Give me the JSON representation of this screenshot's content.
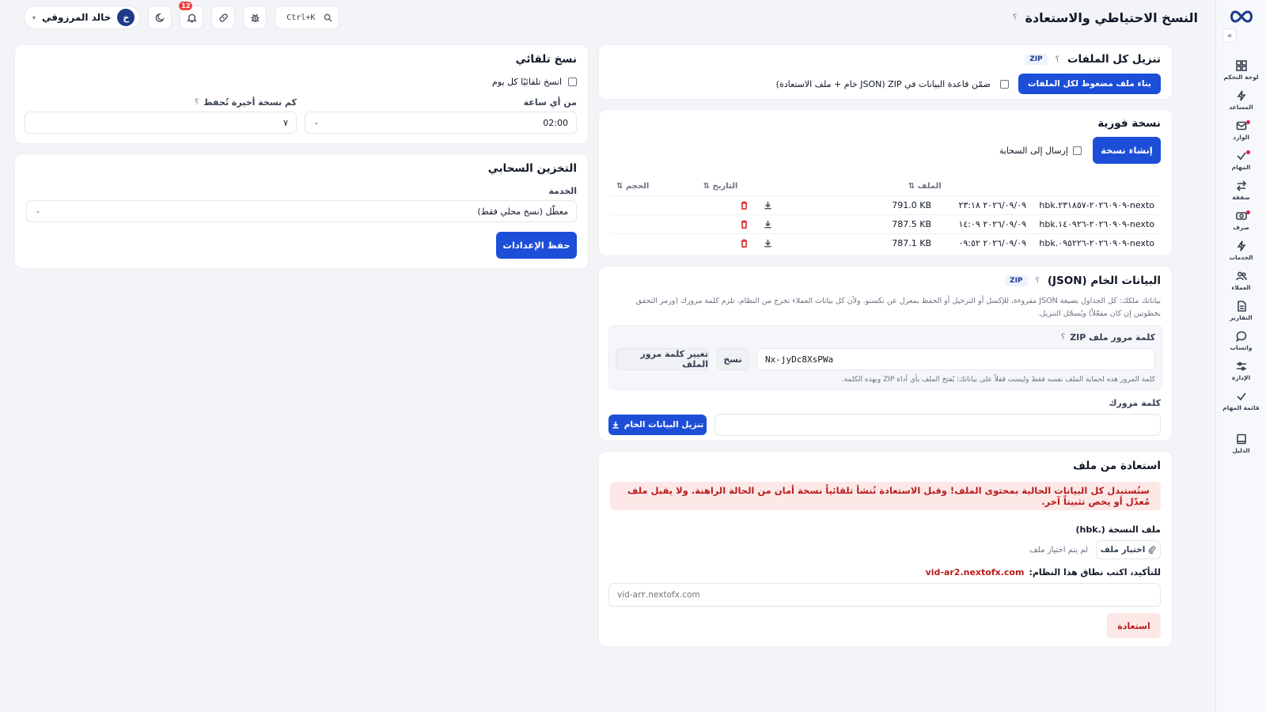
{
  "header": {
    "title": "النسخ الاحتياطي والاستعادة",
    "help": "؟",
    "user_name": "خالد المرزوقي",
    "user_initial": "خ",
    "notifications_count": "12",
    "search_shortcut": "Ctrl+K"
  },
  "sidebar": {
    "items": [
      {
        "label": "لوحة التحكم",
        "icon": "grid-icon"
      },
      {
        "label": "المساعد",
        "icon": "bolt-icon"
      },
      {
        "label": "الوارد",
        "icon": "inbox-icon"
      },
      {
        "label": "المهام",
        "icon": "check-icon"
      },
      {
        "label": "صفقة",
        "icon": "arrows-icon"
      },
      {
        "label": "صرف",
        "icon": "cash-icon"
      },
      {
        "label": "الخدمات",
        "icon": "bolt-icon"
      },
      {
        "label": "العملاء",
        "icon": "users-icon"
      },
      {
        "label": "التقارير",
        "icon": "file-icon"
      },
      {
        "label": "واتساب",
        "icon": "chat-icon"
      },
      {
        "label": "الإدارة",
        "icon": "sliders-icon"
      },
      {
        "label": "قائمة المهام",
        "icon": "check-icon"
      }
    ],
    "guide_label": "الدليل"
  },
  "download_all": {
    "title": "تنزيل كل الملفات",
    "tag": "ZIP",
    "help": "؟",
    "build_button": "بناء ملف مضغوط لكل الملفات",
    "include_db_label": "ضمّن قاعدة البيانات في ZIP (JSON خام + ملف الاستعادة)"
  },
  "instant_backup": {
    "title": "نسخة فورية",
    "create_button": "إنشاء نسخة",
    "send_cloud_label": "إرسال إلى السحابة",
    "columns": {
      "file": "الملف ⇅",
      "date": "التاريخ ⇅",
      "size": "الحجم ⇅"
    },
    "rows": [
      {
        "file": "nexto-٢٠٢٦٠٩٠٩-٢٣١٨٥٧.hbk",
        "date": "٢٠٢٦/٠٩/٠٩ ٢٣:١٨",
        "size": "791.0 KB"
      },
      {
        "file": "nexto-٢٠٢٦٠٩٠٩-١٤٠٩٢٦.hbk",
        "date": "٢٠٢٦/٠٩/٠٩ ١٤:٠٩",
        "size": "787.5 KB"
      },
      {
        "file": "nexto-٢٠٢٦٠٩٠٩-٠٩٥٢٢٦.hbk",
        "date": "٢٠٢٦/٠٩/٠٩ ٠٩:٥٢",
        "size": "787.1 KB"
      }
    ]
  },
  "raw_data": {
    "title": "البيانات الخام (JSON)",
    "tag": "ZIP",
    "help": "؟",
    "description": "بياناتك ملكك: كل الجداول بصيغة JSON مقروءة، للإكسل أو الترحيل أو الحفظ بمعزل عن نكستو. ولأن كل بيانات العملاء تخرج من النظام، تلزم كلمة مرورك (ورمز التحقق بخطوتين إن كان مفعّلاً) ويُسجّل التنزيل.",
    "zip_password_label": "كلمة مرور ملف ZIP",
    "zip_password_value": "Nx-jyDc8XsPWa",
    "copy_button": "نسخ",
    "change_password_button": "تغيير كلمة مرور الملف",
    "zip_note": "كلمة المرور هذه لحماية الملف نفسه فقط وليست قفلاً على بياناتك؛ يُفتح الملف بأي أداة ZIP وبهذه الكلمة.",
    "your_password_label": "كلمة مرورك",
    "your_password_value": "",
    "download_button": "تنزيل البيانات الخام"
  },
  "restore": {
    "title": "استعادة من ملف",
    "warning": "ستُستبدل كل البيانات الحالية بمحتوى الملف! وقبل الاستعادة تُنشأ تلقائياً نسخة أمان من الحالة الراهنة. ولا يقبل ملف مُعدّل أو يخص تثبيتاً آخر.",
    "file_label": "ملف النسخة (.hbk)",
    "choose_file_button": "اختيار ملف",
    "no_file_text": "لم يتم اختيار ملف",
    "confirm_label": "للتأكيد، اكتب نطاق هذا النظام:",
    "confirm_domain": "vid-ar2.nextofx.com",
    "confirm_placeholder": "vid-ar٢.nextofx.com",
    "restore_button": "استعادة"
  },
  "auto_backup": {
    "title": "نسخ تلقائي",
    "daily_label": "انسخ تلقائيًا كل يوم",
    "hour_label": "من أي ساعة",
    "hour_value": "02:00",
    "keep_label": "كم نسخة أخيرة تُحفظ",
    "keep_help": "؟",
    "keep_value": "٧"
  },
  "cloud_storage": {
    "title": "التخزين السحابي",
    "service_label": "الخدمة",
    "service_value": "معطّل (نسخ محلي فقط)",
    "save_button": "حفظ الإعدادات"
  },
  "colors": {
    "primary": "#1d4ed8",
    "danger": "#b91c1c",
    "danger_bg": "#fde8e8"
  }
}
